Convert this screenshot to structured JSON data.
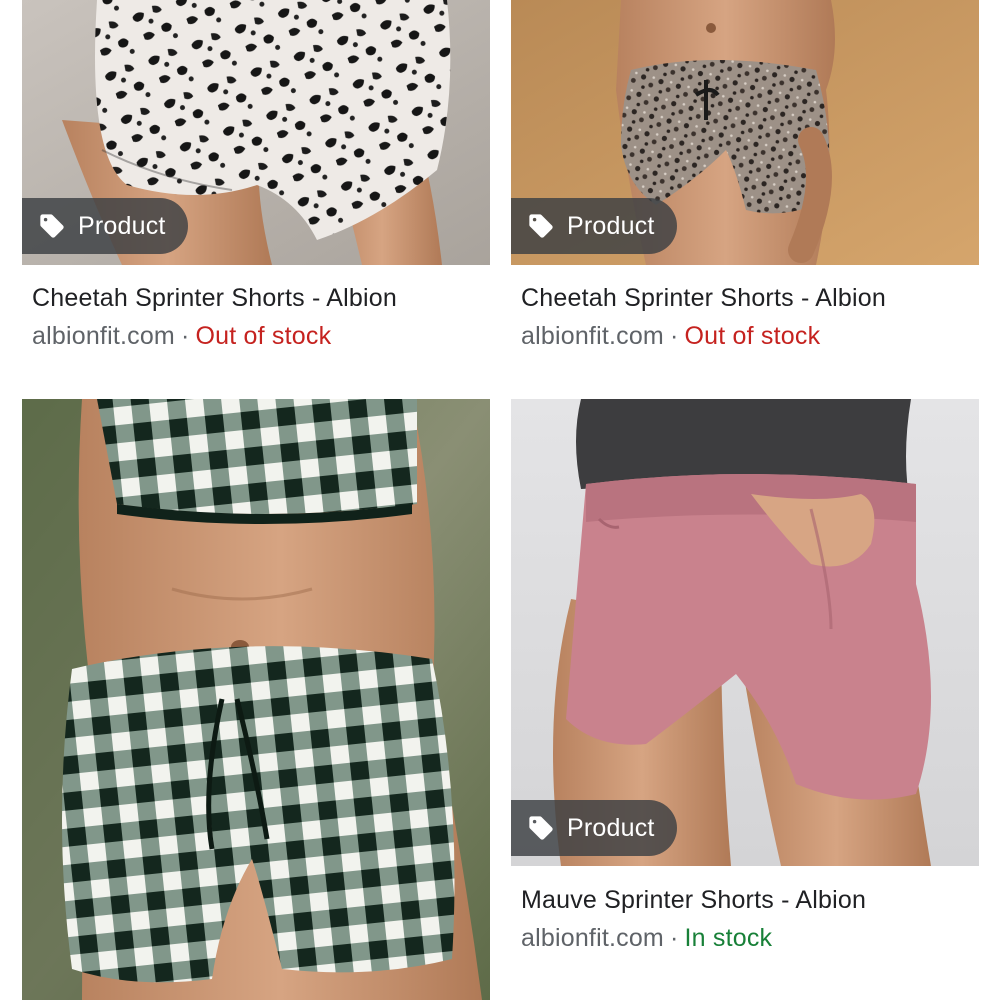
{
  "results": [
    {
      "badge": "Product",
      "title": "Cheetah Sprinter Shorts - Albion",
      "site": "albionfit.com",
      "separator": "·",
      "stock": "Out of stock"
    },
    {
      "badge": "Product",
      "title": "Cheetah Sprinter Shorts - Albion",
      "site": "albionfit.com",
      "separator": "·",
      "stock": "Out of stock"
    },
    {
      "badge": "",
      "title": "",
      "site": "",
      "separator": "",
      "stock": ""
    },
    {
      "badge": "Product",
      "title": "Mauve Sprinter Shorts - Albion",
      "site": "albionfit.com",
      "separator": "·",
      "stock": "In stock"
    }
  ],
  "icons": {
    "badge_icon": "price-tag-icon"
  },
  "colors": {
    "out_of_stock": "#c5221f",
    "in_stock": "#188038",
    "site": "#5f6368",
    "title": "#202124",
    "badge_bg": "#3c4043"
  }
}
